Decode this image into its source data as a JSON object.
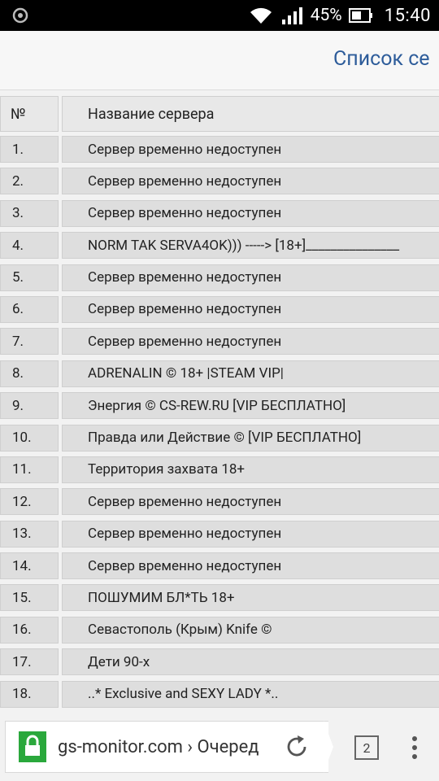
{
  "status_bar": {
    "battery": "45%",
    "time": "15:40"
  },
  "page": {
    "title": "Список се"
  },
  "table": {
    "headers": [
      "№",
      "Название сервера"
    ],
    "rows": [
      [
        "1.",
        "Сервер временно недоступен"
      ],
      [
        "2.",
        "Сервер временно недоступен"
      ],
      [
        "3.",
        "Сервер временно недоступен"
      ],
      [
        "4.",
        "NORM TAK SERVA4OK))) -----> [18+]_______________"
      ],
      [
        "5.",
        "Сервер временно недоступен"
      ],
      [
        "6.",
        "Сервер временно недоступен"
      ],
      [
        "7.",
        "Сервер временно недоступен"
      ],
      [
        "8.",
        "ADRENALIN © 18+ |STEAM VIP|"
      ],
      [
        "9.",
        "Энергия © CS-REW.RU [VIP БЕСПЛАТНО]"
      ],
      [
        "10.",
        "Правда или Действие © [VIP БЕСПЛАТНО]"
      ],
      [
        "11.",
        "Территория захвата 18+"
      ],
      [
        "12.",
        "Сервер временно недоступен"
      ],
      [
        "13.",
        "Сервер временно недоступен"
      ],
      [
        "14.",
        "Сервер временно недоступен"
      ],
      [
        "15.",
        "ПОШУМИМ БЛ*ТЬ 18+"
      ],
      [
        "16.",
        "Севастополь (Крым) Knife ©"
      ],
      [
        "17.",
        "Дети 90-х"
      ],
      [
        "18.",
        "..* Exclusive and SEXY LADY *.."
      ]
    ]
  },
  "browser": {
    "url": "gs-monitor.com › Очеред",
    "tab_count": "2"
  },
  "colors": {
    "title": "#2d5c9a",
    "lock": "#2aa83c",
    "cell": "#dedede"
  }
}
